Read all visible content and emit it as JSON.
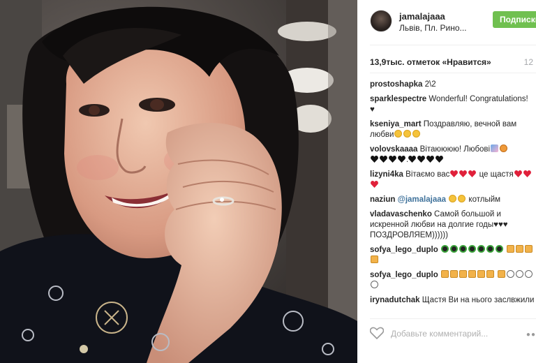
{
  "post": {
    "username": "jamalajaaa",
    "location": "Львів, Пл. Рино...",
    "follow_label": "Подписки",
    "likes": "13,9тыс. отметок «Нравится»",
    "age": "12",
    "comments": [
      {
        "author": "prostoshapka",
        "text": " 2\\2"
      },
      {
        "author": "sparklespectre",
        "text": " Wonderful! Congratulations! ♥"
      },
      {
        "author": "kseniya_mart",
        "text": " Поздравляю, вечной вам любви"
      },
      {
        "author": "volovskaaaa",
        "text": " Вітаюююю! Любові"
      },
      {
        "author": "lizyni4ka",
        "text": " Вітаємо вас"
      },
      {
        "author": "naziun",
        "mention": "@jamalajaaa",
        "text": " котлыйм"
      },
      {
        "author": "vladavaschenko",
        "text": " Самой большой и искренной любви на долгие годы♥♥♥ ПОЗДРОВЛЯЕМ))))))"
      },
      {
        "author": "sofya_lego_duplo",
        "text": ""
      },
      {
        "author": "sofya_lego_duplo",
        "text": ""
      },
      {
        "author": "irynadutchak",
        "text": " Щастя Ви на нього заслвжили"
      }
    ],
    "lizyni4ka_tail": " це щастя",
    "comment_placeholder": "Добавьте комментарий...",
    "more_glyph": "●●"
  },
  "icons": {
    "heart_outline": "heart-outline-icon",
    "more": "more-options-icon"
  },
  "colors": {
    "follow_button": "#70c050",
    "mention": "#3f729b",
    "muted": "#a5a7aa"
  }
}
